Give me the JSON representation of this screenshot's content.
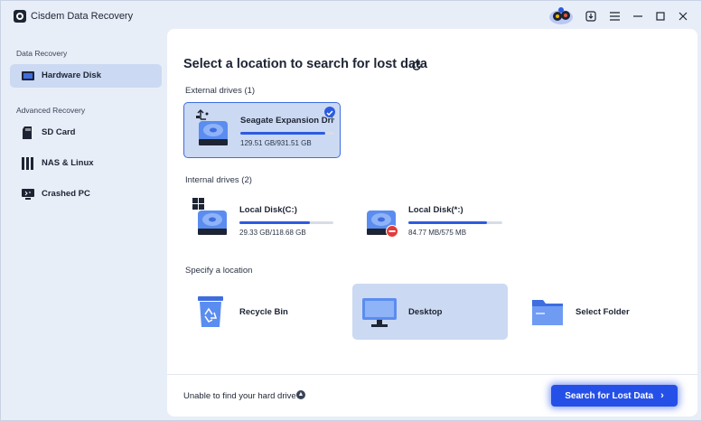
{
  "window": {
    "title": "Cisdem Data Recovery",
    "controls": [
      "download-icon",
      "menu-icon",
      "minimize-icon",
      "maximize-icon",
      "close-icon"
    ]
  },
  "sidebar": {
    "section_data_recovery": "Data Recovery",
    "section_advanced": "Advanced Recovery",
    "items": [
      {
        "label": "Hardware Disk",
        "icon": "hardware-disk-icon",
        "active": true
      },
      {
        "label": "SD Card",
        "icon": "sd-card-icon",
        "active": false
      },
      {
        "label": "NAS & Linux",
        "icon": "nas-icon",
        "active": false
      },
      {
        "label": "Crashed PC",
        "icon": "crashed-pc-icon",
        "active": false
      }
    ]
  },
  "main": {
    "title": "Select a location to search for lost data",
    "external_label": "External drives (1)",
    "internal_label": "Internal drives (2)",
    "location_label": "Specify a location",
    "external_drives": [
      {
        "name": "Seagate Expansion Drive...",
        "size": "129.51 GB/931.51 GB",
        "used_fraction": 0.9,
        "selected": true
      }
    ],
    "internal_drives": [
      {
        "name": "Local Disk(C:)",
        "size": "29.33 GB/118.68 GB",
        "used_fraction": 0.75
      },
      {
        "name": "Local Disk(*:)",
        "size": "84.77 MB/575 MB",
        "used_fraction": 0.84
      }
    ],
    "locations": [
      {
        "name": "Recycle Bin",
        "icon": "recycle-bin-icon"
      },
      {
        "name": "Desktop",
        "icon": "desktop-icon",
        "highlighted": true
      },
      {
        "name": "Select Folder",
        "icon": "folder-icon"
      }
    ],
    "footer_text": "Unable to find your hard drive?",
    "search_button": "Search for Lost Data"
  },
  "colors": {
    "accent": "#2d5be0",
    "button": "#2550e8",
    "selected_bg": "#cbd9f2",
    "app_bg": "#e8eef8"
  }
}
